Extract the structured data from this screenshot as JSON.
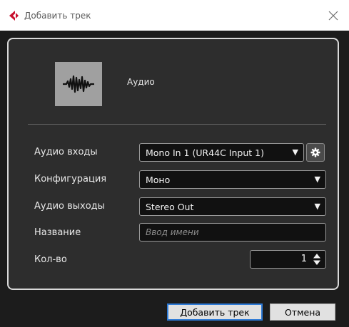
{
  "window": {
    "title": "Добавить трек",
    "logo_icon": "cubase-logo-icon",
    "close_icon": "close-icon"
  },
  "track_type": {
    "icon": "audio-waveform-icon",
    "label": "Аудио"
  },
  "fields": {
    "inputs": {
      "label": "Аудио входы",
      "value": "Mono In 1 (UR44C Input 1)",
      "arrow": "▼",
      "settings_icon": "gear-icon"
    },
    "configuration": {
      "label": "Конфигурация",
      "value": "Моно",
      "arrow": "▼"
    },
    "outputs": {
      "label": "Аудио выходы",
      "value": "Stereo Out",
      "arrow": "▼"
    },
    "name": {
      "label": "Название",
      "value": "",
      "placeholder": "Ввод имени"
    },
    "count": {
      "label": "Кол-во",
      "value": "1"
    }
  },
  "buttons": {
    "add": "Добавить трек",
    "cancel": "Отмена"
  },
  "colors": {
    "logo_red": "#c8102e",
    "focus_border": "#2d7ad6",
    "panel_bg": "#2d2d2d",
    "dialog_bg": "#1c1c1c"
  }
}
